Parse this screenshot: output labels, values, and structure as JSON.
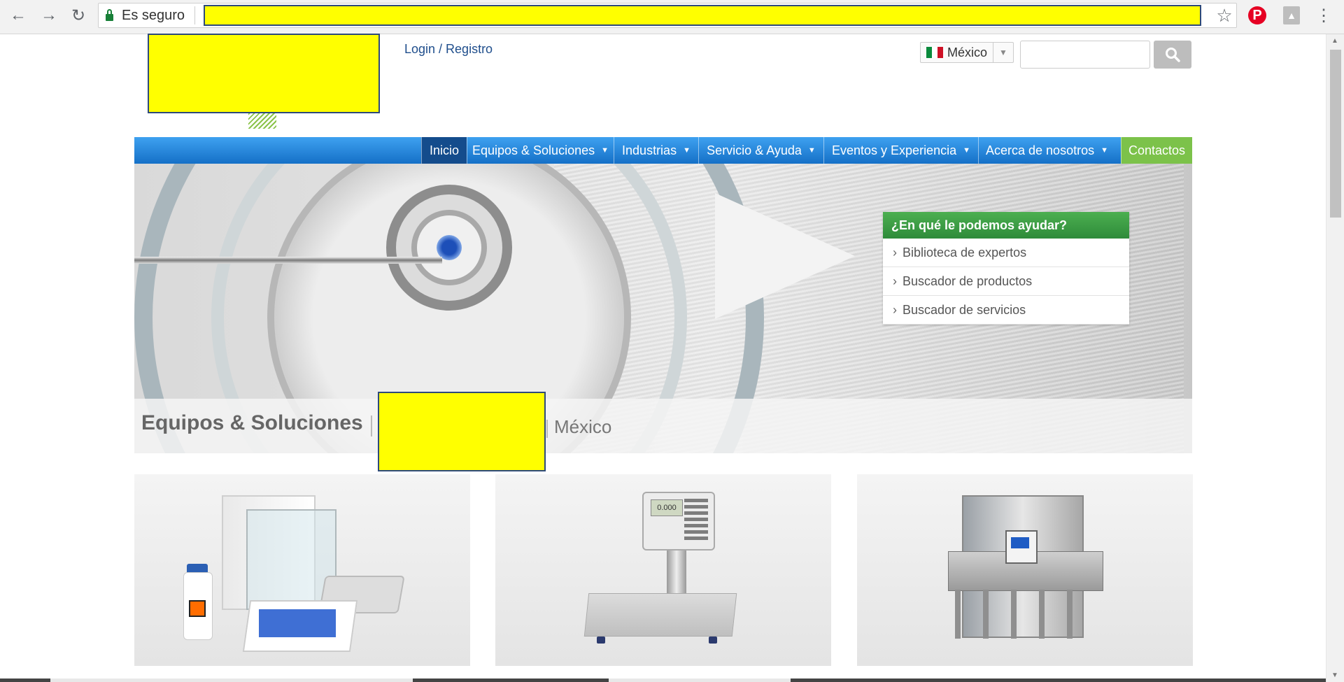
{
  "browser": {
    "security_label": "Es seguro",
    "icons": {
      "back": "arrow-left-icon",
      "forward": "arrow-right-icon",
      "reload": "reload-icon",
      "bookmark": "star-icon",
      "pinterest": "pinterest-icon",
      "pdf": "pdf-icon",
      "menu": "kebab-menu-icon"
    }
  },
  "header": {
    "login_label": "Login / Registro",
    "country_label": "México",
    "search_placeholder": ""
  },
  "nav": {
    "items": [
      {
        "label": "Inicio",
        "has_dropdown": false
      },
      {
        "label": "Equipos & Soluciones",
        "has_dropdown": true
      },
      {
        "label": "Industrias",
        "has_dropdown": true
      },
      {
        "label": "Servicio & Ayuda",
        "has_dropdown": true
      },
      {
        "label": "Eventos y Experiencia",
        "has_dropdown": true
      },
      {
        "label": "Acerca de nosotros",
        "has_dropdown": true
      },
      {
        "label": "Contactos",
        "has_dropdown": false
      }
    ],
    "chevron": "⌄"
  },
  "help": {
    "title": "¿En qué le podemos ayudar?",
    "links": [
      "Biblioteca de expertos",
      "Buscador de productos",
      "Buscador de servicios"
    ]
  },
  "page_title": {
    "main": "Equipos & Soluciones",
    "country": "México"
  },
  "products": {
    "scale_display": "0.000"
  },
  "colors": {
    "nav_blue": "#1570c7",
    "nav_active": "#144c8c",
    "contact_green": "#7cc24a",
    "help_green": "#2e8b3a",
    "redaction_yellow": "#ffff00"
  }
}
